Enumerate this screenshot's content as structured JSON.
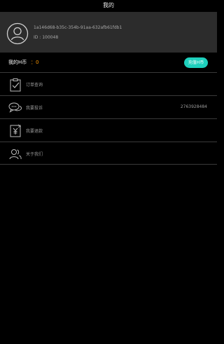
{
  "header": {
    "title": "我的"
  },
  "profile": {
    "avatar_icon": "user-avatar-icon",
    "user_id": "1a146d68-b35c-354b-91aa-632afb61fdb1",
    "id_line": "ID : 100048"
  },
  "coins": {
    "label": "我的H币",
    "value": "：0",
    "value_color": "#ff9900",
    "recharge_label": "充值H币",
    "recharge_color": "#1ed0bd"
  },
  "menu": {
    "items": [
      {
        "label": "订单查询",
        "icon": "clipboard-check-icon",
        "extra": ""
      },
      {
        "label": "我要投诉",
        "icon": "chat-bubbles-icon",
        "extra": "2763928484"
      },
      {
        "label": "我要退款",
        "icon": "refund-yen-icon",
        "extra": ""
      },
      {
        "label": "关于我们",
        "icon": "users-icon",
        "extra": ""
      }
    ]
  }
}
